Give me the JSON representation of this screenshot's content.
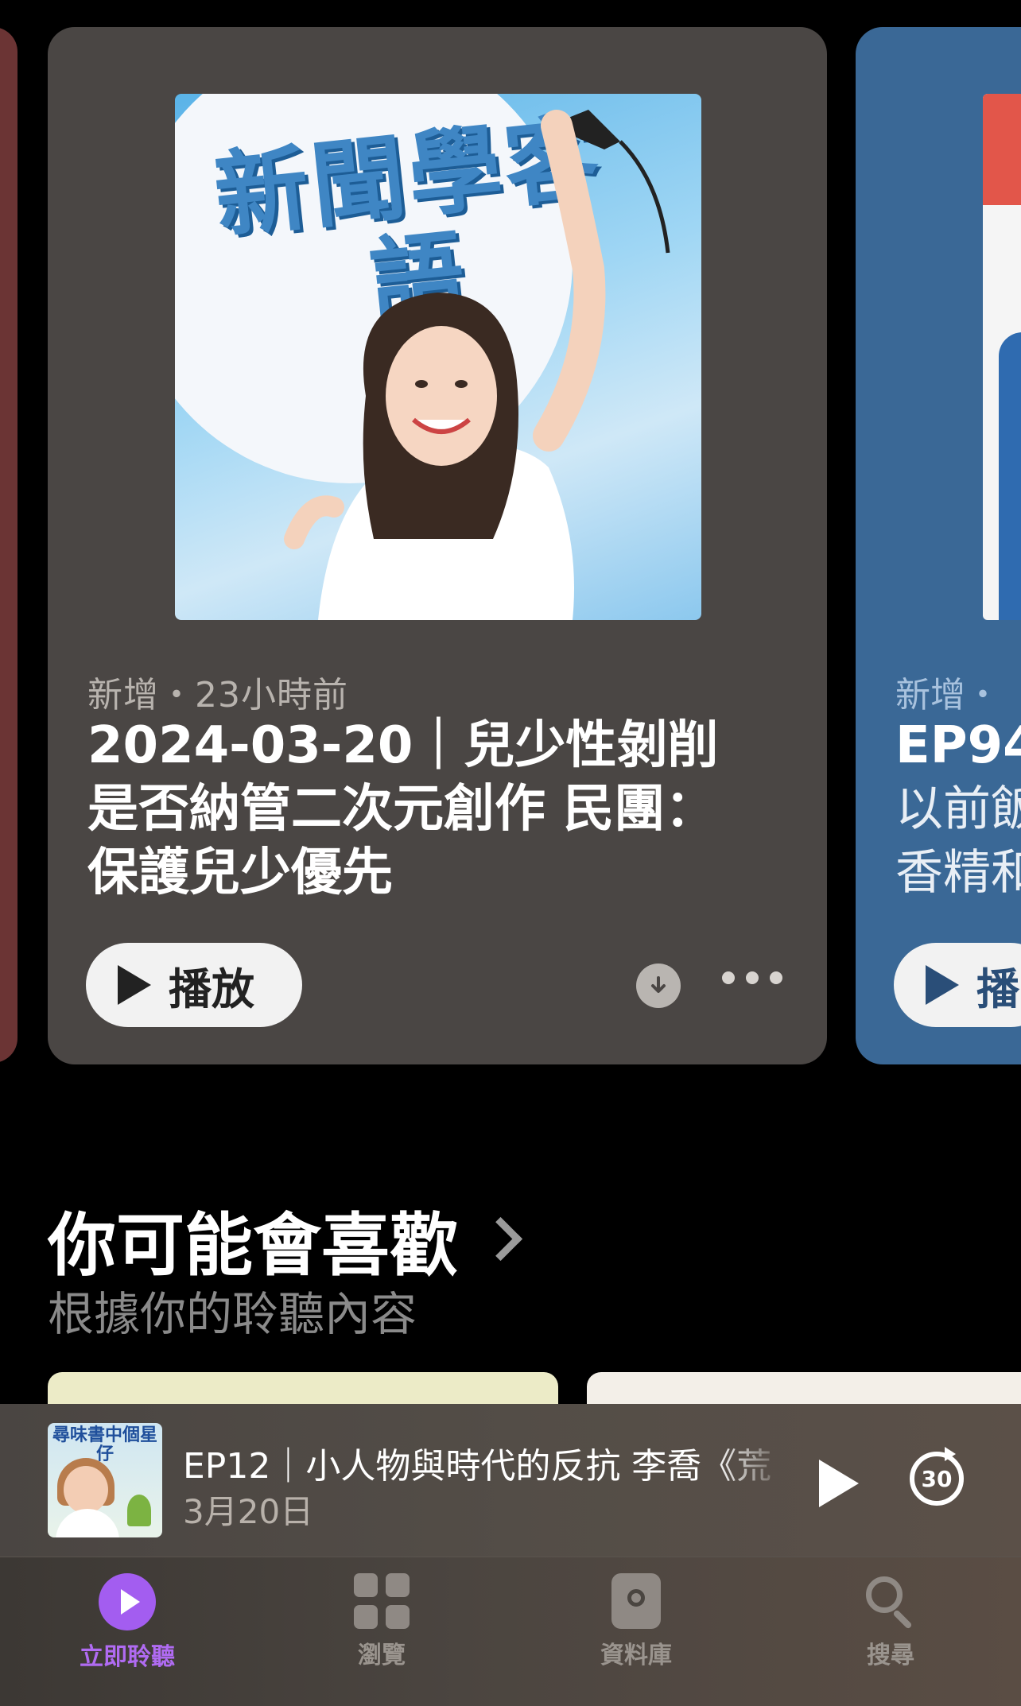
{
  "episode_card": {
    "meta": "新增・23小時前",
    "title": "2024-03-20｜兒少性剝削是否納管二次元創作 民團：保護兒少優先",
    "artwork_text": "新聞學客語",
    "play_label": "播放"
  },
  "next_card": {
    "meta": "新增・",
    "title": "EP94",
    "subtitle": "以前飯\n香精和",
    "play_label": "播"
  },
  "section": {
    "title": "你可能會喜歡",
    "subtitle": "根據你的聆聽內容"
  },
  "mini_player": {
    "artwork_text": "尋味書中個星仔",
    "title": "EP12｜小人物與時代的反抗 李喬《荒",
    "date": "3月20日",
    "skip_label": "30"
  },
  "tabs": [
    {
      "label": "立即聆聽",
      "icon": "play-circle-icon",
      "active": true
    },
    {
      "label": "瀏覽",
      "icon": "grid-icon",
      "active": false
    },
    {
      "label": "資料庫",
      "icon": "library-podcast-icon",
      "active": false
    },
    {
      "label": "搜尋",
      "icon": "search-icon",
      "active": false
    }
  ],
  "colors": {
    "accent": "#a35df0",
    "card_main": "#4a4644",
    "card_next": "#3a6896",
    "card_prev": "#6b3434"
  }
}
